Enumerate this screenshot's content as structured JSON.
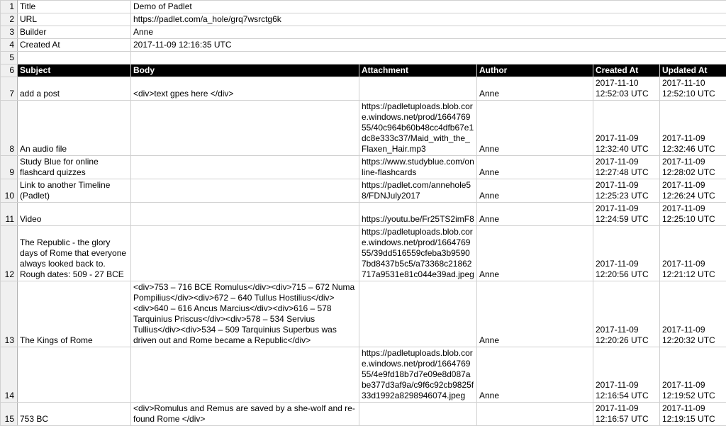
{
  "meta_rows": [
    {
      "num": "1",
      "label": "Title",
      "value": "Demo of Padlet"
    },
    {
      "num": "2",
      "label": "URL",
      "value": "https://padlet.com/a_hole/grq7wsrctg6k"
    },
    {
      "num": "3",
      "label": "Builder",
      "value": "Anne"
    },
    {
      "num": "4",
      "label": "Created At",
      "value": "2017-11-09 12:16:35 UTC"
    },
    {
      "num": "5",
      "label": "",
      "value": ""
    }
  ],
  "header": {
    "num": "6",
    "subject": "Subject",
    "body": "Body",
    "attachment": "Attachment",
    "author": "Author",
    "created": "Created At",
    "updated": "Updated At"
  },
  "rows": [
    {
      "num": "7",
      "subject": "add a post",
      "body": "<div>text gpes here </div>",
      "attachment": "",
      "author": "Anne",
      "created": "2017-11-10 12:52:03 UTC",
      "updated": "2017-11-10 12:52:10 UTC"
    },
    {
      "num": "8",
      "subject": "An audio file",
      "body": "",
      "attachment": "https://padletuploads.blob.core.windows.net/prod/166476955/40c964b60b48cc4dfb67e1dc8e333c37/Maid_with_the_Flaxen_Hair.mp3",
      "author": "Anne",
      "created": "2017-11-09 12:32:40 UTC",
      "updated": "2017-11-09 12:32:46 UTC"
    },
    {
      "num": "9",
      "subject": "Study Blue for online flashcard quizzes",
      "body": "",
      "attachment": "https://www.studyblue.com/online-flashcards",
      "author": "Anne",
      "created": "2017-11-09 12:27:48 UTC",
      "updated": "2017-11-09 12:28:02 UTC"
    },
    {
      "num": "10",
      "subject": "Link to another Timeline (Padlet)",
      "body": "",
      "attachment": "https://padlet.com/annehole58/FDNJuly2017",
      "author": "Anne",
      "created": "2017-11-09 12:25:23 UTC",
      "updated": "2017-11-09 12:26:24 UTC"
    },
    {
      "num": "11",
      "subject": "Video",
      "body": "",
      "attachment": "https://youtu.be/Fr25TS2imF8",
      "author": "Anne",
      "created": "2017-11-09 12:24:59 UTC",
      "updated": "2017-11-09 12:25:10 UTC"
    },
    {
      "num": "12",
      "subject": "The Republic - the glory days of Rome that everyone always looked back to. Rough dates: 509 - 27 BCE",
      "body": "",
      "attachment": "https://padletuploads.blob.core.windows.net/prod/166476955/39dd516559cfeba3b95907bd8437b5c5/a73368c21862717a9531e81c044e39ad.jpeg",
      "author": "Anne",
      "created": "2017-11-09 12:20:56 UTC",
      "updated": "2017-11-09 12:21:12 UTC"
    },
    {
      "num": "13",
      "subject": "The Kings of Rome",
      "body": "<div>753 – 716 BCE Romulus</div><div>715 – 672 Numa Pompilius</div><div>672 – 640 Tullus Hostilius</div><div>640 – 616 Ancus Marcius</div><div>616 – 578 Tarquinius Priscus</div><div>578 – 534 Servius Tullius</div><div>534 – 509 Tarquinius Superbus was driven out and Rome became a Republic</div>",
      "attachment": "",
      "author": "Anne",
      "created": "2017-11-09 12:20:26 UTC",
      "updated": "2017-11-09 12:20:32 UTC"
    },
    {
      "num": "14",
      "subject": "",
      "body": "",
      "attachment": "https://padletuploads.blob.core.windows.net/prod/166476955/4e9fd18b7d7e09e8d087abe377d3af9a/c9f6c92cb9825f33d1992a8298946074.jpeg",
      "author": "Anne",
      "created": "2017-11-09 12:16:54 UTC",
      "updated": "2017-11-09 12:19:52 UTC"
    },
    {
      "num": "15",
      "subject": "753 BC",
      "body": "<div>Romulus and Remus are saved by a she-wolf and re-found Rome </div>",
      "attachment": "",
      "author": "",
      "created": "2017-11-09 12:16:57 UTC",
      "updated": "2017-11-09 12:19:15 UTC"
    }
  ]
}
